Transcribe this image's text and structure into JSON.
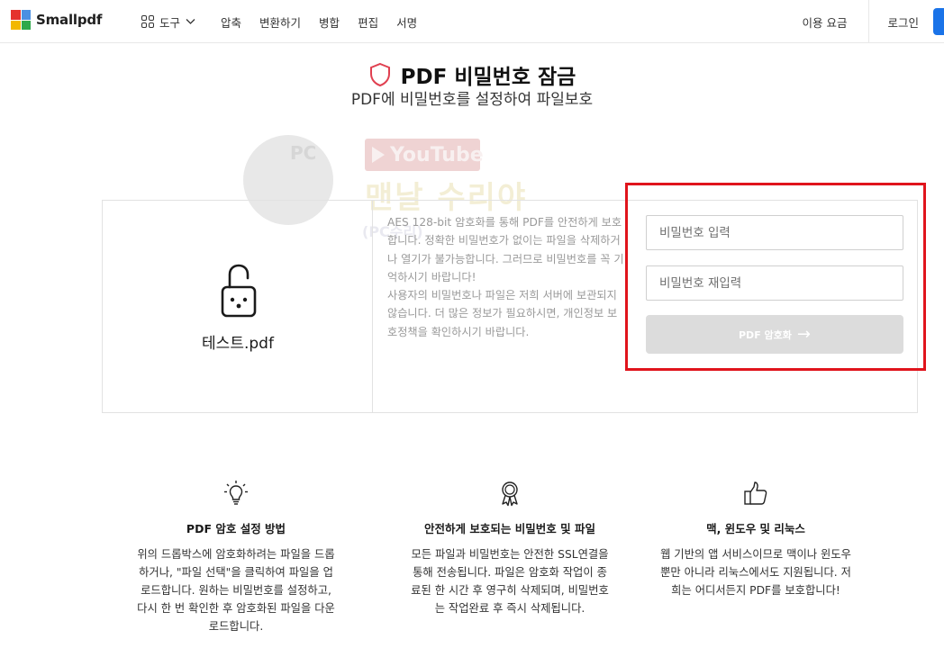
{
  "header": {
    "logo_text": "Smallpdf",
    "nav_tools": "도구",
    "nav_items": [
      "압축",
      "변환하기",
      "병합",
      "편집",
      "서명"
    ],
    "pricing": "이용 요금",
    "login": "로그인"
  },
  "page": {
    "title": "PDF 비밀번호 잠금",
    "subtitle": "PDF에 비밀번호를 설정하여 파일보호"
  },
  "watermark": {
    "circle_text": "PC",
    "youtube": "YouTube",
    "main": "맨날 수리야",
    "sub": "(PC수리)"
  },
  "file": {
    "name": "테스트.pdf"
  },
  "description": {
    "para1": "AES 128-bit 암호화를 통해 PDF를 안전하게 보호합니다. 정확한 비밀번호가 없이는 파일을 삭제하거나 열기가 불가능합니다. 그러므로 비밀번호를 꼭 기억하시기 바랍니다!",
    "para2": "사용자의 비밀번호나 파일은 저희 서버에 보관되지 않습니다. 더 많은 정보가 필요하시면, 개인정보 보호정책을 확인하시기 바랍니다."
  },
  "form": {
    "password_placeholder": "비밀번호 입력",
    "password_value": "",
    "confirm_placeholder": "비밀번호 재입력",
    "confirm_value": "",
    "submit_label": "PDF 암호화"
  },
  "features": [
    {
      "icon": "lightbulb-icon",
      "title": "PDF 암호 설정 방법",
      "desc": "위의 드롭박스에 암호화하려는 파일을 드롭하거나, \"파일 선택\"을 클릭하여 파일을 업로드합니다. 원하는 비밀번호를 설정하고, 다시 한 번 확인한 후 암호화된 파일을 다운로드합니다."
    },
    {
      "icon": "award-icon",
      "title": "안전하게 보호되는 비밀번호 및 파일",
      "desc": "모든 파일과 비밀번호는 안전한 SSL연결을 통해 전송됩니다. 파일은 암호화 작업이 종료된 한 시간 후 영구히 삭제되며, 비밀번호는 작업완료 후 즉시 삭제됩니다."
    },
    {
      "icon": "thumbs-up-icon",
      "title": "맥, 윈도우 및 리눅스",
      "desc": "웹 기반의 앱 서비스이므로 맥이나 윈도우뿐만 아니라 리눅스에서도 지원됩니다. 저희는 어디서든지 PDF를 보호합니다!"
    }
  ],
  "colors": {
    "accent_blue": "#1a73e8",
    "highlight_red": "#e0141c",
    "shield_red": "#e04050",
    "button_disabled": "#dcdcdc"
  }
}
